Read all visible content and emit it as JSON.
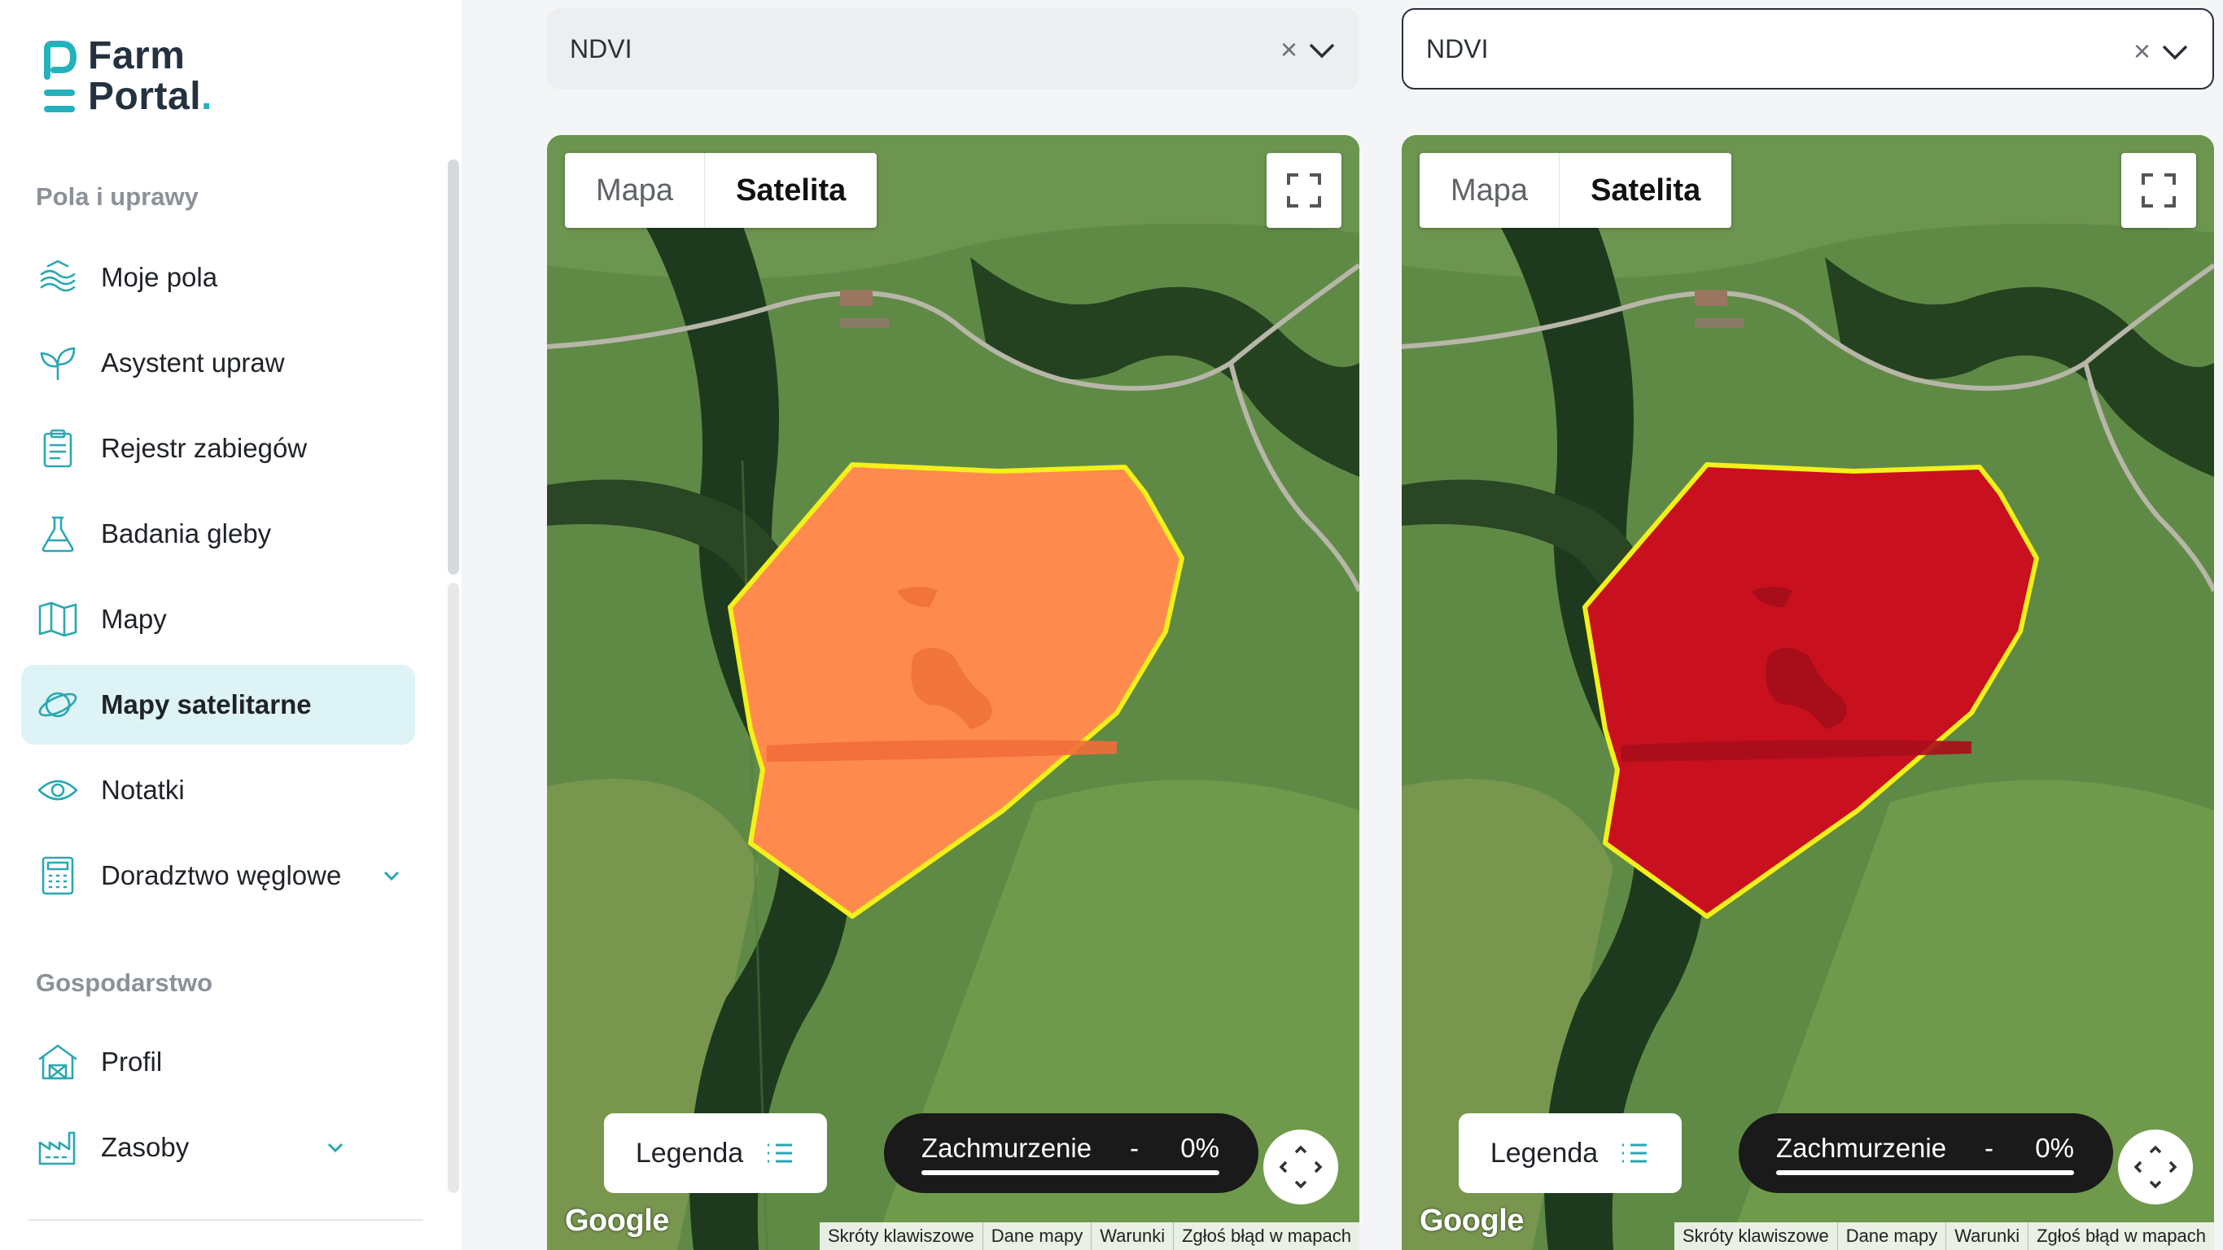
{
  "app": {
    "logo_line1": "Farm",
    "logo_line2": "Portal",
    "logo_dot": "."
  },
  "sidebar": {
    "section1_title": "Pola i uprawy",
    "section2_title": "Gospodarstwo",
    "items": [
      {
        "label": "Moje pola",
        "icon": "fields-icon"
      },
      {
        "label": "Asystent upraw",
        "icon": "sprout-icon"
      },
      {
        "label": "Rejestr zabiegów",
        "icon": "clipboard-icon"
      },
      {
        "label": "Badania gleby",
        "icon": "flask-icon"
      },
      {
        "label": "Mapy",
        "icon": "map-icon"
      },
      {
        "label": "Mapy satelitarne",
        "icon": "satellite-planet-icon",
        "active": true
      },
      {
        "label": "Notatki",
        "icon": "eye-icon"
      },
      {
        "label": "Doradztwo węglowe",
        "icon": "calculator-icon",
        "expandable": true
      }
    ],
    "items2": [
      {
        "label": "Profil",
        "icon": "barn-icon"
      },
      {
        "label": "Zasoby",
        "icon": "factory-icon",
        "expandable": true
      }
    ]
  },
  "selects": {
    "left": {
      "value": "NDVI",
      "clear": "×"
    },
    "right": {
      "value": "NDVI",
      "clear": "×"
    }
  },
  "maps": {
    "toggle_map": "Mapa",
    "toggle_satellite": "Satelita",
    "legend": "Legenda",
    "cloud_label": "Zachmurzenie",
    "cloud_dash": "-",
    "cloud_value": "0%",
    "google": "Google",
    "attribution": [
      "Skróty klawiszowe",
      "Dane mapy",
      "Warunki",
      "Zgłoś błąd w mapach"
    ],
    "left_field_color": "#ff8a4d",
    "right_field_color": "#c8101f",
    "field_outline_color": "#f3f01a"
  }
}
